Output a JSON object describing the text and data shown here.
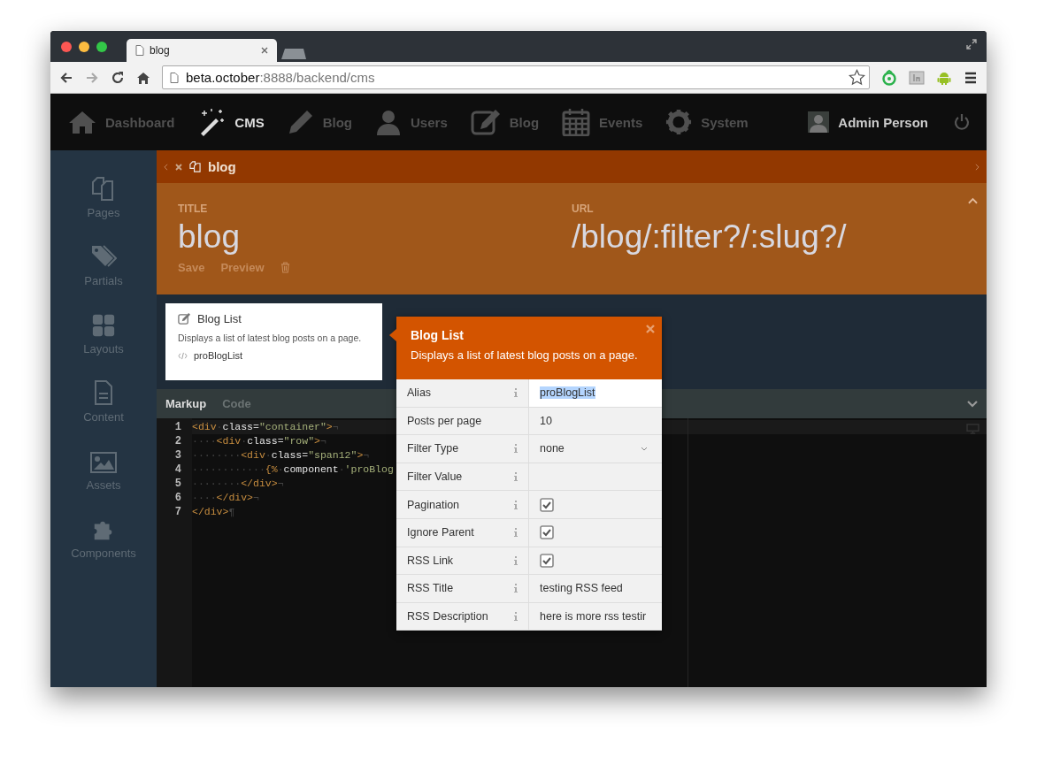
{
  "browser": {
    "tab": {
      "title": "blog"
    },
    "address": {
      "host": "beta.october",
      "path": ":8888/backend/cms"
    }
  },
  "nav": {
    "items": [
      {
        "label": "Dashboard",
        "selected": false
      },
      {
        "label": "CMS",
        "selected": true
      },
      {
        "label": "Blog",
        "selected": false
      },
      {
        "label": "Users",
        "selected": false
      },
      {
        "label": "Blog",
        "selected": false
      },
      {
        "label": "Events",
        "selected": false
      },
      {
        "label": "System",
        "selected": false
      }
    ],
    "user": "Admin Person"
  },
  "sidebar": {
    "items": [
      {
        "label": "Pages"
      },
      {
        "label": "Partials"
      },
      {
        "label": "Layouts"
      },
      {
        "label": "Content"
      },
      {
        "label": "Assets"
      },
      {
        "label": "Components"
      }
    ]
  },
  "doc_tab": {
    "title": "blog"
  },
  "header": {
    "title_label": "TITLE",
    "title": "blog",
    "url_label": "URL",
    "url": "/blog/:filter?/:slug?/",
    "actions": [
      "Save",
      "Preview"
    ]
  },
  "component_card": {
    "title": "Blog List",
    "description": "Displays a list of latest blog posts on a page.",
    "alias": "proBlogList"
  },
  "editor": {
    "tabs": [
      {
        "label": "Markup",
        "selected": true
      },
      {
        "label": "Code",
        "selected": false
      }
    ],
    "lines": [
      {
        "number": "1",
        "tokens": [
          {
            "kind": "tag",
            "text": "<div"
          },
          {
            "kind": "ws",
            "text": "·"
          },
          {
            "kind": "attr",
            "text": "class"
          },
          {
            "kind": "punct",
            "text": "="
          },
          {
            "kind": "str",
            "text": "\"container\""
          },
          {
            "kind": "tag",
            "text": ">"
          },
          {
            "kind": "ws",
            "text": "¬"
          }
        ]
      },
      {
        "number": "2",
        "tokens": [
          {
            "kind": "ws",
            "text": "····"
          },
          {
            "kind": "tag",
            "text": "<div"
          },
          {
            "kind": "ws",
            "text": "·"
          },
          {
            "kind": "attr",
            "text": "class"
          },
          {
            "kind": "punct",
            "text": "="
          },
          {
            "kind": "str",
            "text": "\"row\""
          },
          {
            "kind": "tag",
            "text": ">"
          },
          {
            "kind": "ws",
            "text": "¬"
          }
        ]
      },
      {
        "number": "3",
        "tokens": [
          {
            "kind": "ws",
            "text": "········"
          },
          {
            "kind": "tag",
            "text": "<div"
          },
          {
            "kind": "ws",
            "text": "·"
          },
          {
            "kind": "attr",
            "text": "class"
          },
          {
            "kind": "punct",
            "text": "="
          },
          {
            "kind": "str",
            "text": "\"span12\""
          },
          {
            "kind": "tag",
            "text": ">"
          },
          {
            "kind": "ws",
            "text": "¬"
          }
        ]
      },
      {
        "number": "4",
        "tokens": [
          {
            "kind": "ws",
            "text": "············"
          },
          {
            "kind": "tag",
            "text": "{%"
          },
          {
            "kind": "ws",
            "text": "·"
          },
          {
            "kind": "attr",
            "text": "component"
          },
          {
            "kind": "ws",
            "text": "·"
          },
          {
            "kind": "str",
            "text": "'proBlog"
          }
        ]
      },
      {
        "number": "5",
        "tokens": [
          {
            "kind": "ws",
            "text": "········"
          },
          {
            "kind": "tag",
            "text": "</div>"
          },
          {
            "kind": "ws",
            "text": "¬"
          }
        ]
      },
      {
        "number": "6",
        "tokens": [
          {
            "kind": "ws",
            "text": "····"
          },
          {
            "kind": "tag",
            "text": "</div>"
          },
          {
            "kind": "ws",
            "text": "¬"
          }
        ]
      },
      {
        "number": "7",
        "tokens": [
          {
            "kind": "tag",
            "text": "</div>"
          },
          {
            "kind": "ws",
            "text": "¶"
          }
        ]
      }
    ]
  },
  "inspector": {
    "title": "Blog List",
    "description": "Displays a list of latest blog posts on a page.",
    "rows": [
      {
        "label": "Alias",
        "info": true,
        "kind": "input",
        "value": "proBlogList"
      },
      {
        "label": "Posts per page",
        "info": false,
        "kind": "text",
        "value": "10"
      },
      {
        "label": "Filter Type",
        "info": true,
        "kind": "dropdown",
        "value": "none"
      },
      {
        "label": "Filter Value",
        "info": true,
        "kind": "text"
      },
      {
        "label": "Pagination",
        "info": true,
        "kind": "checkbox",
        "checked": true
      },
      {
        "label": "Ignore Parent",
        "info": true,
        "kind": "checkbox",
        "checked": true
      },
      {
        "label": "RSS Link",
        "info": true,
        "kind": "checkbox",
        "checked": true
      },
      {
        "label": "RSS Title",
        "info": true,
        "kind": "text",
        "value": "testing RSS feed"
      },
      {
        "label": "RSS Description",
        "info": true,
        "kind": "text",
        "value": "here is more rss testir"
      }
    ]
  }
}
